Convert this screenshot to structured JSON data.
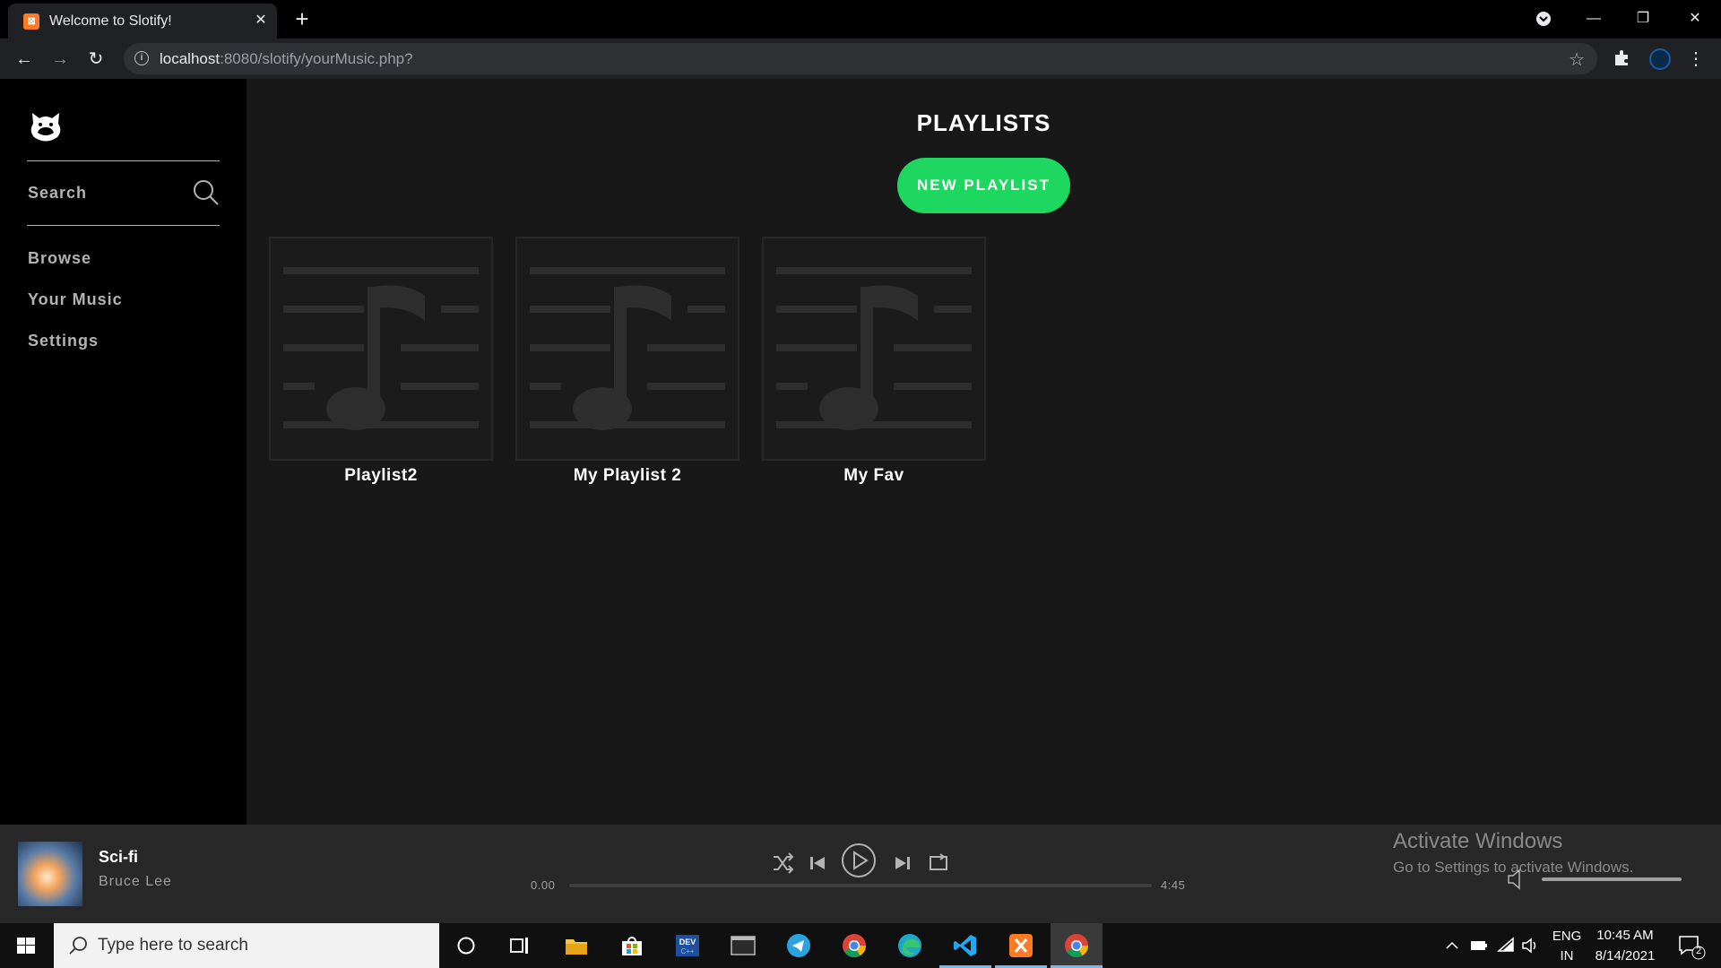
{
  "browser": {
    "tab_title": "Welcome to Slotify!",
    "tab_favicon": "xampp-icon",
    "url_host": "localhost",
    "url_rest": ":8080/slotify/yourMusic.php?"
  },
  "sidebar": {
    "search_label": "Search",
    "nav": [
      {
        "label": "Browse"
      },
      {
        "label": "Your Music"
      },
      {
        "label": "Settings"
      }
    ]
  },
  "main": {
    "title": "PLAYLISTS",
    "new_playlist_label": "NEW PLAYLIST",
    "playlists": [
      {
        "name": "Playlist2"
      },
      {
        "name": "My Playlist 2"
      },
      {
        "name": "My Fav"
      }
    ]
  },
  "player": {
    "track": "Sci-fi",
    "artist": "Bruce Lee",
    "current_time": "0.00",
    "duration": "4:45",
    "progress_fraction": 0.0,
    "volume_fraction": 1.0
  },
  "watermark": {
    "title": "Activate Windows",
    "subtitle": "Go to Settings to activate Windows."
  },
  "taskbar": {
    "search_placeholder": "Type here to search",
    "language_top": "ENG",
    "language_bottom": "IN",
    "time": "10:45 AM",
    "date": "8/14/2021",
    "notification_count": "2"
  },
  "colors": {
    "accent_green": "#1ed760",
    "sidebar_bg": "#000000",
    "main_bg": "#181818",
    "player_bg": "#282828"
  }
}
